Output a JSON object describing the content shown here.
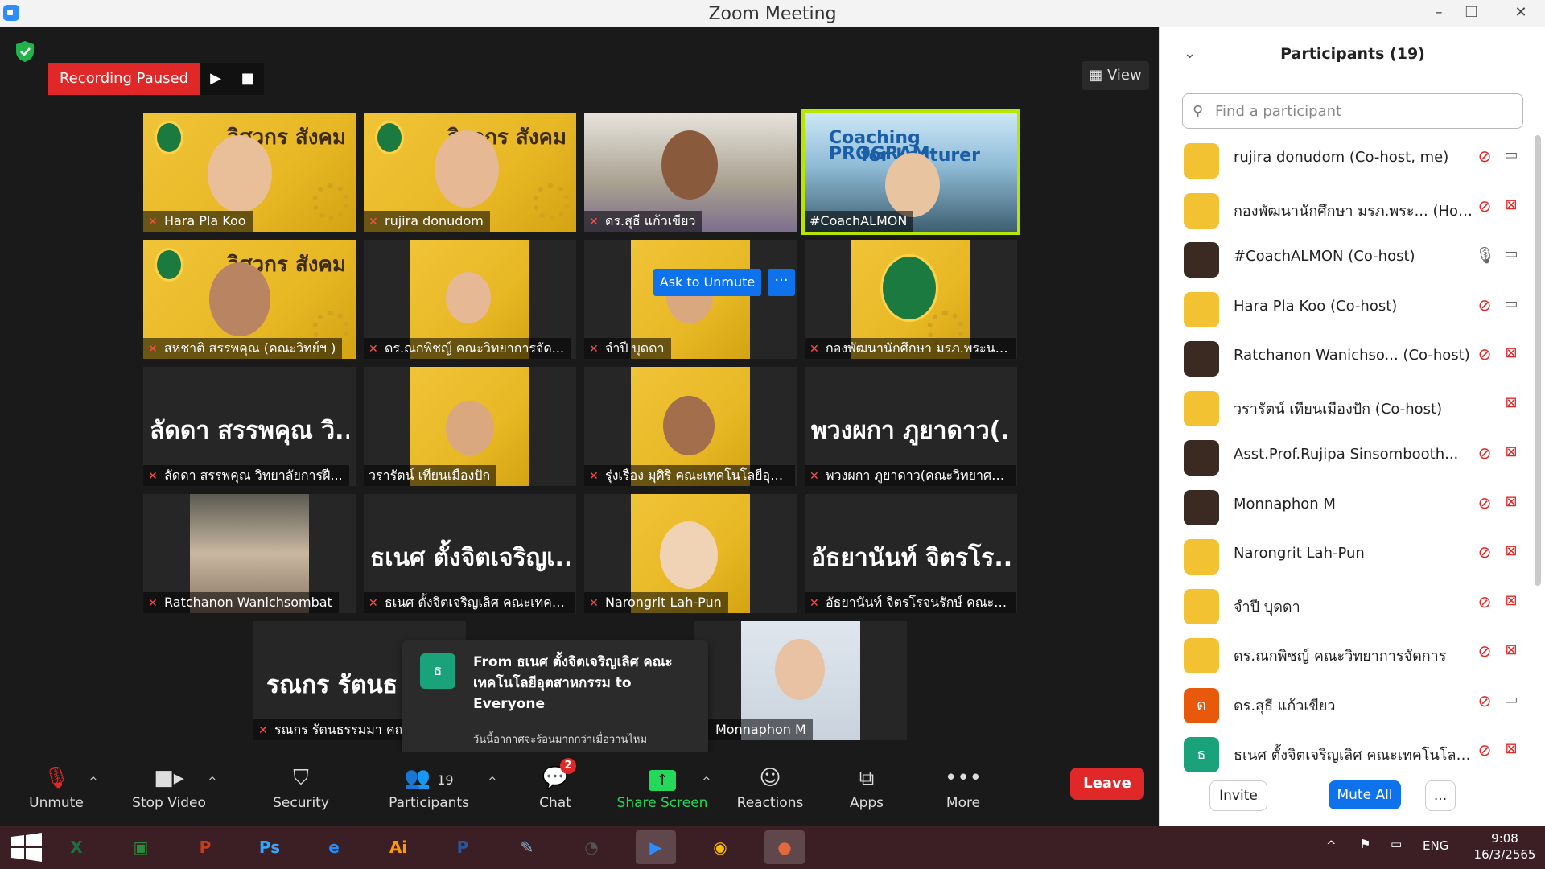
{
  "window": {
    "title": "Zoom Meeting",
    "minimize": "–",
    "restore": "❐",
    "close": "✕"
  },
  "recording": {
    "status": "Recording Paused",
    "play": "▶",
    "stop": "■"
  },
  "view_button": "View",
  "tiles": [
    {
      "name": "Hara Pla Koo",
      "muted": true
    },
    {
      "name": "rujira donudom",
      "muted": true
    },
    {
      "name": "ดร.สุธี แก้วเขียว",
      "muted": true
    },
    {
      "name": "#CoachALMON",
      "muted": false,
      "banner": "Coaching PROGRAM",
      "banner2": "for Lecturer"
    },
    {
      "name": "สหชาติ สรรพคุณ (คณะวิทย์ฯ )",
      "muted": true
    },
    {
      "name": "ดร.ณกพิชญ์ คณะวิทยาการจัด...",
      "muted": true
    },
    {
      "name": "จำปี บุดดา",
      "muted": true
    },
    {
      "name": "กองพัฒนานักศึกษา มรภ.พระนคร",
      "muted": true
    },
    {
      "name": "ลัดดา สรรพคุณ วิทยาลัยการฝี...",
      "muted": true,
      "big": "ลัดดา สรรพคุณ วิ..."
    },
    {
      "name": "วรารัตน์ เทียนเมืองปัก",
      "muted": false
    },
    {
      "name": "รุ่งเรือง มุศิริ คณะเทคโนโลยีอุตส...",
      "muted": true
    },
    {
      "name": "พวงผกา ภูยาดาว(คณะวิทยาศา...",
      "muted": true,
      "big": "พวงผกา ภูยาดาว(..."
    },
    {
      "name": "Ratchanon Wanichsombat",
      "muted": true
    },
    {
      "name": "ธเนศ ตั้งจิตเจริญเลิศ คณะเทคโน...",
      "muted": true,
      "big": "ธเนศ ตั้งจิตเจริญเ..."
    },
    {
      "name": "Narongrit Lah-Pun",
      "muted": true
    },
    {
      "name": "อัธยานันท์ จิตรโรจนรักษ์ คณะเท...",
      "muted": true,
      "big": "อัธยานันท์ จิตรโร..."
    },
    {
      "name": "รณกร รัตนธรรมมา คณ",
      "muted": true,
      "big": "รณกร รัตนธ"
    },
    {
      "name": "Monnaphon M",
      "muted": true
    }
  ],
  "brand_text": "วิศวกร สังคม",
  "ask_to_unmute": "Ask to Unmute",
  "tile_more": "···",
  "chat_popup": {
    "avatar": "ธ",
    "title": "From ธเนศ ตั้งจิตเจริญเลิศ คณะเทคโนโลยีอุตสาหกรรม to Everyone",
    "message": "วันนี้อากาศจะร้อนมากกว่าเมื่อวานไหม"
  },
  "toolbar": {
    "unmute": "Unmute",
    "stop_video": "Stop Video",
    "security": "Security",
    "participants": "Participants",
    "participants_count": "19",
    "chat": "Chat",
    "chat_badge": "2",
    "share_screen": "Share Screen",
    "reactions": "Reactions",
    "apps": "Apps",
    "more": "More",
    "leave": "Leave",
    "caret": "^"
  },
  "panel": {
    "title": "Participants (19)",
    "search_placeholder": "Find a participant",
    "invite": "Invite",
    "mute_all": "Mute All",
    "more": "...",
    "participants": [
      {
        "name": "rujira donudom (Co-host, me)",
        "mic": "muted",
        "cam": "on",
        "avatar": "y"
      },
      {
        "name": "กองพัฒนานักศึกษา มรภ.พระ... (Host)",
        "mic": "muted",
        "cam": "off",
        "avatar": "y"
      },
      {
        "name": "#CoachALMON (Co-host)",
        "mic": "on",
        "cam": "on",
        "avatar": "photo"
      },
      {
        "name": "Hara Pla Koo (Co-host)",
        "mic": "muted",
        "cam": "on",
        "avatar": "y"
      },
      {
        "name": "Ratchanon Wanichso... (Co-host)",
        "mic": "muted",
        "cam": "off",
        "avatar": "photo"
      },
      {
        "name": "วรารัตน์ เทียนเมืองปัก (Co-host)",
        "mic": "none",
        "cam": "off",
        "avatar": "y"
      },
      {
        "name": "Asst.Prof.Rujipa Sinsombooth...",
        "mic": "muted",
        "cam": "off",
        "avatar": "photo"
      },
      {
        "name": "Monnaphon M",
        "mic": "muted",
        "cam": "off",
        "avatar": "photo"
      },
      {
        "name": "Narongrit Lah-Pun",
        "mic": "muted",
        "cam": "off",
        "avatar": "y"
      },
      {
        "name": "จำปี บุดดา",
        "mic": "muted",
        "cam": "off",
        "avatar": "y"
      },
      {
        "name": "ดร.ณกพิชญ์ คณะวิทยาการจัดการ",
        "mic": "muted",
        "cam": "off",
        "avatar": "y"
      },
      {
        "name": "ดร.สุธี แก้วเขียว",
        "mic": "muted",
        "cam": "on",
        "avatar": "letter",
        "letter": "ด",
        "color": "#e8590c"
      },
      {
        "name": "ธเนศ ตั้งจิตเจริญเลิศ คณะเทคโนโลยีอุ...",
        "mic": "muted",
        "cam": "off",
        "avatar": "letter",
        "letter": "ธ",
        "color": "#1aa37a"
      }
    ]
  },
  "taskbar": {
    "apps": [
      "X",
      "▣",
      "P",
      "Ps",
      "e",
      "Ai",
      "P",
      "✎",
      "◔",
      "▶",
      "◉",
      "●"
    ],
    "lang": "ENG",
    "time": "9:08",
    "date": "16/3/2565",
    "tray_up": "^"
  }
}
